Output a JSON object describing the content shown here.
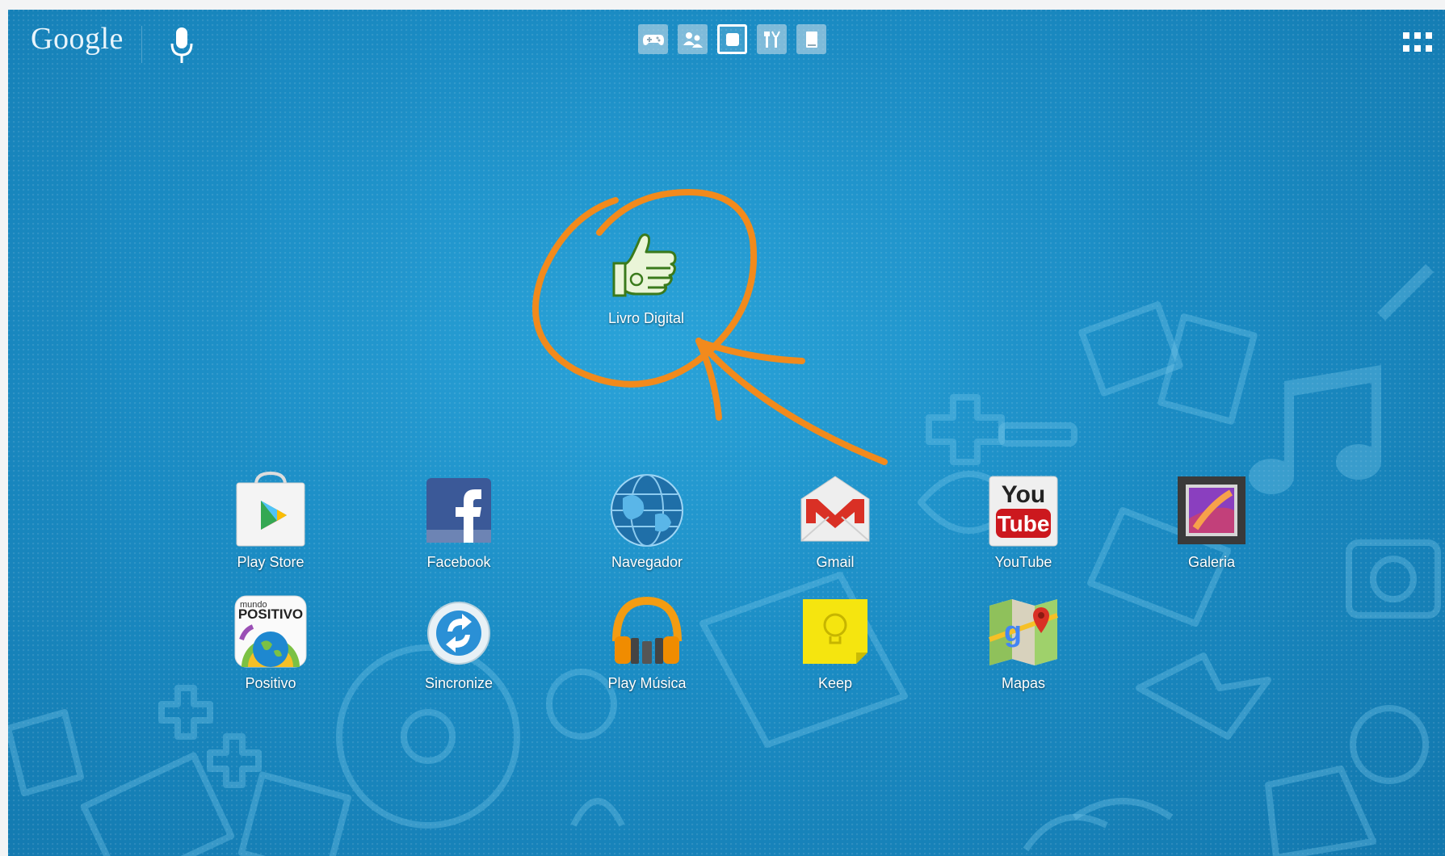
{
  "topbar": {
    "google_label": "Google",
    "category_tabs": [
      {
        "icon": "gamepad-icon"
      },
      {
        "icon": "people-icon"
      },
      {
        "icon": "home-square-icon",
        "active": true
      },
      {
        "icon": "tools-icon"
      },
      {
        "icon": "book-icon"
      }
    ]
  },
  "featured_app": {
    "label": "Livro Digital",
    "icon": "thumbs-up-icon"
  },
  "apps": [
    {
      "label": "Play Store",
      "icon": "play-store-icon"
    },
    {
      "label": "Facebook",
      "icon": "facebook-icon"
    },
    {
      "label": "Navegador",
      "icon": "globe-icon"
    },
    {
      "label": "Gmail",
      "icon": "gmail-icon"
    },
    {
      "label": "YouTube",
      "icon": "youtube-icon"
    },
    {
      "label": "Galeria",
      "icon": "gallery-icon"
    },
    {
      "label": "Positivo",
      "icon": "positivo-icon"
    },
    {
      "label": "Sincronize",
      "icon": "sync-icon"
    },
    {
      "label": "Play Música",
      "icon": "headphones-icon"
    },
    {
      "label": "Keep",
      "icon": "keep-icon"
    },
    {
      "label": "Mapas",
      "icon": "maps-icon"
    }
  ],
  "youtube_logo": {
    "line1": "You",
    "line2": "Tube"
  },
  "positivo_logo": {
    "line1": "mundo",
    "line2": "POSITIVO"
  },
  "colors": {
    "wallpaper": "#1b8cc4",
    "annotation": "#f28a1c",
    "gmail_red": "#d93025",
    "youtube_red": "#cc181e",
    "facebook_blue": "#3b5998",
    "keep_yellow": "#f5e50f"
  }
}
